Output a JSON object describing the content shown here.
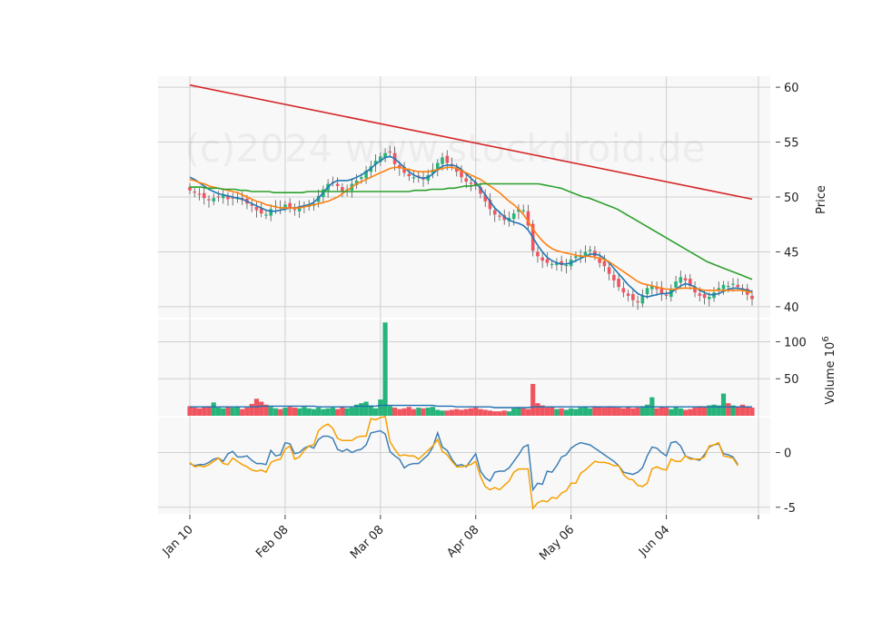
{
  "watermark": "(c)2024 www.stockdroid.de",
  "colors": {
    "up": "#26b47a",
    "down": "#f0555f",
    "ma_fast": "#1f77b4",
    "ma_mid": "#ff7f0e",
    "ma_slow": "#2ca02c",
    "ma_long": "#d62728",
    "osc_line": "#3f7fb5",
    "osc_signal": "#f5a000",
    "volume_ma": "#1f6fb4"
  },
  "chart_data": [
    {
      "type": "candlestick",
      "panel": "price",
      "ylabel": "Price",
      "ylim": [
        39,
        61
      ],
      "yticks": [
        40,
        45,
        50,
        55,
        60
      ],
      "x_tick_labels": [
        "Jan 10",
        "Feb 08",
        "Mar 08",
        "Apr 08",
        "May 06",
        "Jun 04"
      ],
      "x_tick_index": [
        0,
        20,
        40,
        60,
        80,
        100
      ],
      "grid": true,
      "close": [
        50.6,
        50.4,
        50.2,
        49.9,
        49.7,
        49.9,
        50.0,
        50.2,
        49.8,
        49.9,
        50.0,
        49.7,
        49.4,
        49.2,
        48.8,
        48.5,
        48.4,
        48.9,
        49.2,
        49.1,
        49.3,
        49.0,
        48.8,
        49.1,
        49.2,
        49.3,
        49.4,
        50.1,
        50.7,
        51.2,
        51.3,
        51.0,
        50.5,
        50.7,
        51.2,
        51.5,
        51.8,
        52.4,
        52.8,
        53.3,
        53.7,
        54.0,
        54.1,
        53.0,
        52.6,
        52.2,
        51.9,
        51.8,
        51.9,
        51.6,
        52.0,
        52.5,
        53.1,
        53.6,
        53.1,
        52.8,
        52.3,
        51.8,
        51.4,
        51.2,
        51.0,
        50.3,
        49.6,
        48.9,
        48.4,
        48.2,
        47.9,
        48.1,
        48.5,
        48.9,
        48.8,
        47.4,
        45.1,
        44.6,
        44.2,
        44.0,
        43.9,
        44.0,
        43.8,
        43.8,
        44.3,
        44.6,
        44.7,
        45.0,
        45.2,
        44.6,
        44.0,
        43.7,
        43.0,
        42.4,
        41.8,
        41.3,
        41.0,
        40.6,
        40.4,
        41.0,
        41.7,
        41.9,
        41.6,
        41.2,
        41.0,
        41.6,
        42.3,
        42.7,
        42.4,
        41.9,
        41.3,
        41.0,
        40.8,
        40.9,
        41.3,
        41.7,
        42.0,
        41.9,
        42.1,
        41.8,
        41.5,
        41.1,
        40.7
      ],
      "series": [
        {
          "name": "",
          "kind": "ma",
          "values": [
            51.8,
            51.6,
            51.3,
            51.0,
            50.7,
            50.5,
            50.3,
            50.2,
            50.1,
            50.0,
            49.9,
            49.8,
            49.6,
            49.4,
            49.2,
            49.0,
            48.8,
            48.7,
            48.7,
            48.8,
            48.9,
            49.0,
            49.0,
            49.1,
            49.2,
            49.3,
            49.5,
            49.9,
            50.4,
            50.9,
            51.3,
            51.5,
            51.5,
            51.5,
            51.6,
            51.8,
            52.0,
            52.3,
            52.6,
            53.0,
            53.3,
            53.6,
            53.7,
            53.5,
            53.1,
            52.7,
            52.3,
            52.0,
            51.8,
            51.7,
            51.8,
            52.1,
            52.5,
            52.8,
            52.9,
            52.9,
            52.8,
            52.5,
            52.1,
            51.7,
            51.3,
            50.8,
            50.2,
            49.6,
            49.0,
            48.6,
            48.2,
            47.9,
            47.7,
            47.6,
            47.4,
            47.0,
            46.3,
            45.6,
            45.0,
            44.5,
            44.2,
            44.0,
            43.9,
            43.9,
            44.0,
            44.2,
            44.4,
            44.6,
            44.8,
            44.8,
            44.7,
            44.4,
            44.0,
            43.5,
            43.0,
            42.5,
            42.0,
            41.6,
            41.2,
            41.0,
            40.9,
            41.0,
            41.1,
            41.2,
            41.2,
            41.3,
            41.6,
            41.9,
            42.1,
            42.0,
            41.8,
            41.5,
            41.3,
            41.1,
            41.1,
            41.2,
            41.4,
            41.6,
            41.7,
            41.7,
            41.6,
            41.5,
            41.4
          ]
        },
        {
          "name": "",
          "kind": "ma",
          "values": [
            51.6,
            51.5,
            51.3,
            51.2,
            51.0,
            50.9,
            50.8,
            50.7,
            50.6,
            50.5,
            50.4,
            50.2,
            50.0,
            49.8,
            49.6,
            49.5,
            49.3,
            49.2,
            49.1,
            49.0,
            49.0,
            49.0,
            49.0,
            49.0,
            49.1,
            49.2,
            49.3,
            49.4,
            49.5,
            49.6,
            49.8,
            50.0,
            50.3,
            50.6,
            50.9,
            51.2,
            51.4,
            51.6,
            51.8,
            52.0,
            52.2,
            52.4,
            52.6,
            52.7,
            52.7,
            52.6,
            52.5,
            52.4,
            52.3,
            52.3,
            52.3,
            52.4,
            52.5,
            52.6,
            52.7,
            52.7,
            52.6,
            52.4,
            52.2,
            52.0,
            51.8,
            51.6,
            51.3,
            51.0,
            50.7,
            50.4,
            50.0,
            49.6,
            49.3,
            48.9,
            48.4,
            47.8,
            47.1,
            46.5,
            46.0,
            45.6,
            45.3,
            45.1,
            45.0,
            44.9,
            44.8,
            44.7,
            44.6,
            44.6,
            44.6,
            44.5,
            44.4,
            44.3,
            44.1,
            43.8,
            43.5,
            43.2,
            42.9,
            42.6,
            42.3,
            42.1,
            42.0,
            41.9,
            41.8,
            41.7,
            41.6,
            41.6,
            41.6,
            41.7,
            41.7,
            41.7,
            41.7,
            41.6,
            41.5,
            41.5,
            41.5,
            41.5,
            41.5,
            41.5,
            41.5,
            41.5,
            41.5,
            41.4,
            41.3
          ]
        },
        {
          "name": "",
          "kind": "ma",
          "values": [
            50.9,
            50.9,
            50.9,
            50.8,
            50.8,
            50.8,
            50.7,
            50.7,
            50.7,
            50.6,
            50.6,
            50.5,
            50.5,
            50.5,
            50.5,
            50.4,
            50.4,
            50.4,
            50.4,
            50.4,
            50.4,
            50.5,
            50.5,
            50.5,
            50.5,
            50.5,
            50.5,
            50.5,
            50.5,
            50.5,
            50.5,
            50.5,
            50.5,
            50.5,
            50.5,
            50.5,
            50.5,
            50.5,
            50.5,
            50.5,
            50.6,
            50.6,
            50.6,
            50.7,
            50.7,
            50.7,
            50.8,
            50.8,
            50.9,
            51.0,
            51.0,
            51.1,
            51.2,
            51.2,
            51.2,
            51.2,
            51.2,
            51.2,
            51.2,
            51.2,
            51.2,
            51.2,
            51.2,
            51.1,
            51.0,
            50.9,
            50.8,
            50.6,
            50.4,
            50.2,
            50.0,
            49.9,
            49.7,
            49.5,
            49.3,
            49.1,
            48.9,
            48.6,
            48.3,
            48.0,
            47.7,
            47.4,
            47.1,
            46.8,
            46.5,
            46.2,
            45.9,
            45.6,
            45.3,
            45.0,
            44.7,
            44.4,
            44.1,
            43.9,
            43.7,
            43.5,
            43.3,
            43.1,
            42.9,
            42.7,
            42.5
          ]
        },
        {
          "name": "",
          "kind": "ma",
          "values": [
            60.2,
            49.8
          ]
        }
      ]
    },
    {
      "type": "bar",
      "panel": "volume",
      "ylabel": "Volume  10^6",
      "ylim": [
        0,
        130
      ],
      "yticks": [
        50,
        100
      ],
      "values": [
        13,
        11,
        10,
        12,
        13,
        18,
        11,
        10,
        12,
        11,
        12,
        9,
        11,
        16,
        23,
        19,
        15,
        12,
        10,
        9,
        11,
        12,
        11,
        10,
        12,
        10,
        9,
        11,
        9,
        10,
        11,
        9,
        12,
        10,
        11,
        15,
        17,
        19,
        14,
        10,
        22,
        126,
        13,
        11,
        9,
        10,
        12,
        9,
        11,
        10,
        11,
        12,
        8,
        7,
        7,
        8,
        9,
        8,
        9,
        10,
        11,
        9,
        8,
        7,
        6,
        6,
        7,
        6,
        10,
        11,
        10,
        9,
        43,
        17,
        14,
        11,
        12,
        9,
        10,
        8,
        10,
        9,
        11,
        12,
        10,
        13,
        12,
        11,
        13,
        12,
        11,
        10,
        12,
        10,
        11,
        13,
        15,
        25,
        10,
        12,
        11,
        9,
        12,
        10,
        8,
        9,
        11,
        13,
        12,
        14,
        15,
        14,
        30,
        17,
        14,
        12,
        15,
        12,
        11
      ],
      "ma_values": [
        12,
        12,
        12,
        12,
        12,
        12,
        12,
        12,
        12,
        12,
        12,
        12,
        12,
        12,
        12,
        13,
        13,
        13,
        13,
        13,
        13,
        13,
        13,
        13,
        13,
        13,
        13,
        12,
        12,
        12,
        12,
        12,
        12,
        12,
        12,
        13,
        13,
        13,
        13,
        13,
        14,
        14,
        14,
        14,
        14,
        14,
        14,
        14,
        14,
        14,
        14,
        14,
        13,
        13,
        13,
        13,
        12,
        12,
        12,
        12,
        12,
        12,
        12,
        12,
        11,
        11,
        11,
        11,
        11,
        11,
        11,
        11,
        12,
        12,
        12,
        12,
        12,
        12,
        12,
        12,
        12,
        12,
        12,
        12,
        12,
        12,
        12,
        12,
        12,
        12,
        12,
        12,
        12,
        12,
        12,
        12,
        12,
        12,
        12,
        12,
        12,
        12,
        12,
        12,
        12,
        12,
        12,
        12,
        12,
        12,
        12,
        12,
        12,
        12,
        12,
        12,
        12,
        12,
        12
      ]
    },
    {
      "type": "line",
      "panel": "oscillator",
      "ylim": [
        -5.6,
        3.2
      ],
      "yticks": [
        -5,
        0
      ],
      "series": [
        {
          "name": "",
          "values": [
            -1.0,
            -1.2,
            -1.1,
            -1.1,
            -0.9,
            -0.6,
            -0.5,
            -0.8,
            -0.1,
            0.1,
            -0.4,
            -0.4,
            -0.3,
            -0.7,
            -1.0,
            -1.0,
            -1.1,
            0.2,
            -0.3,
            -0.2,
            0.9,
            0.8,
            -0.1,
            0.0,
            0.4,
            0.6,
            0.4,
            1.2,
            1.5,
            1.5,
            1.3,
            0.3,
            0.1,
            0.3,
            0.0,
            0.2,
            0.3,
            0.7,
            1.8,
            1.9,
            2.0,
            1.7,
            0.1,
            -0.3,
            -0.6,
            -1.4,
            -1.1,
            -1.0,
            -1.0,
            -0.6,
            -0.2,
            0.5,
            1.8,
            0.5,
            0.2,
            -0.6,
            -1.2,
            -1.1,
            -1.3,
            -0.7,
            -0.1,
            -1.7,
            -2.3,
            -2.6,
            -1.8,
            -1.7,
            -1.7,
            -1.4,
            -0.8,
            -0.2,
            0.5,
            0.7,
            -3.4,
            -2.8,
            -2.9,
            -1.7,
            -1.8,
            -1.2,
            -0.4,
            -0.2,
            0.4,
            0.7,
            0.9,
            0.8,
            0.7,
            0.4,
            0.1,
            -0.2,
            -0.5,
            -0.8,
            -1.2,
            -1.8,
            -1.9,
            -2.0,
            -1.8,
            -1.4,
            -0.3,
            0.5,
            0.4,
            0.0,
            -0.3,
            0.9,
            1.0,
            0.6,
            -0.3,
            -0.5,
            -0.6,
            -0.7,
            -0.2,
            0.5,
            0.7,
            0.8,
            -0.1,
            -0.2,
            -0.4,
            -1.1
          ]
        },
        {
          "name": "",
          "values": [
            -0.9,
            -1.3,
            -1.2,
            -1.3,
            -1.1,
            -0.8,
            -0.5,
            -1.0,
            -1.1,
            -0.5,
            -0.8,
            -1.1,
            -1.3,
            -1.6,
            -1.7,
            -1.6,
            -1.8,
            -0.9,
            -0.7,
            -0.6,
            0.3,
            0.6,
            -0.6,
            -0.4,
            0.2,
            0.6,
            0.7,
            2.0,
            2.4,
            2.6,
            2.2,
            1.3,
            1.1,
            1.1,
            1.1,
            1.4,
            1.5,
            1.5,
            3.1,
            3.0,
            3.2,
            3.3,
            1.0,
            0.3,
            -0.3,
            -0.2,
            -0.3,
            -0.3,
            -0.6,
            -0.2,
            0.2,
            0.6,
            1.2,
            0.1,
            -0.2,
            -0.8,
            -1.3,
            -1.3,
            -1.2,
            -1.1,
            -0.8,
            -2.2,
            -3.1,
            -3.4,
            -3.2,
            -3.4,
            -3.0,
            -2.6,
            -1.8,
            -1.5,
            -1.5,
            -1.5,
            -5.1,
            -4.6,
            -4.4,
            -4.5,
            -4.1,
            -4.2,
            -3.7,
            -3.5,
            -2.8,
            -2.8,
            -1.9,
            -1.6,
            -1.2,
            -0.8,
            -0.9,
            -0.9,
            -1.0,
            -1.2,
            -1.2,
            -2.0,
            -2.4,
            -2.5,
            -3.0,
            -3.1,
            -2.8,
            -1.5,
            -1.3,
            -1.5,
            -1.6,
            -0.6,
            -0.8,
            -0.8,
            -0.3,
            -0.6,
            -0.6,
            -0.6,
            -0.4,
            0.6,
            0.7,
            0.9,
            -0.3,
            -0.4,
            -0.5,
            -1.2
          ]
        }
      ]
    }
  ]
}
